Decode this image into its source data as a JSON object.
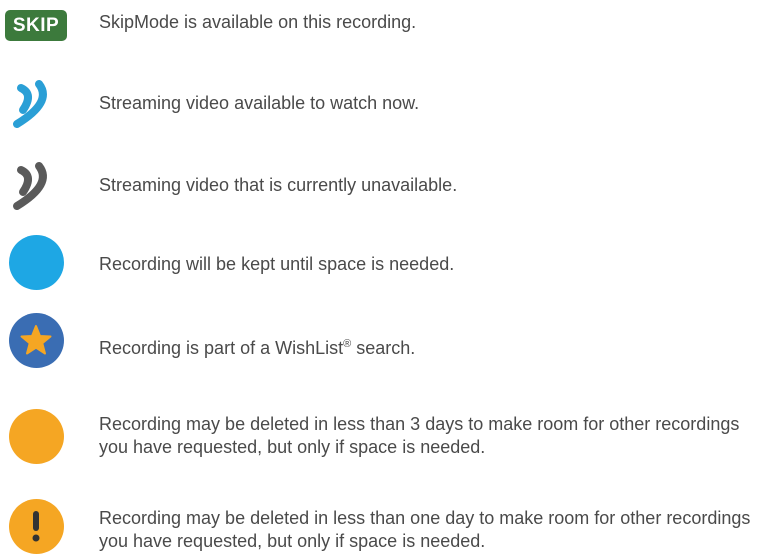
{
  "legend": {
    "items": [
      {
        "icon": "skipmode-badge",
        "badge_text": "SKIP",
        "text": "SkipMode is available on this recording."
      },
      {
        "icon": "streaming-available-icon",
        "color": "#2a9fd6",
        "text": "Streaming video available to watch now."
      },
      {
        "icon": "streaming-unavailable-icon",
        "color": "#5a5a5a",
        "text": "Streaming video that is currently unavailable."
      },
      {
        "icon": "blue-dot-icon",
        "color": "#1ea7e4",
        "text": "Recording will be kept until space is needed."
      },
      {
        "icon": "wishlist-star-icon",
        "color": "#3a6db3",
        "star_color": "#f5a623",
        "text": "Recording is part of a WishList® search."
      },
      {
        "icon": "yellow-dot-icon",
        "color": "#f5a623",
        "text": "Recording may be deleted in less than 3 days to make room for other recordings you have requested, but only if space is needed."
      },
      {
        "icon": "exclamation-dot-icon",
        "color": "#f5a623",
        "text": "Recording may be deleted in less than one day to make room for other recordings you have requested, but only if space is needed."
      }
    ]
  }
}
